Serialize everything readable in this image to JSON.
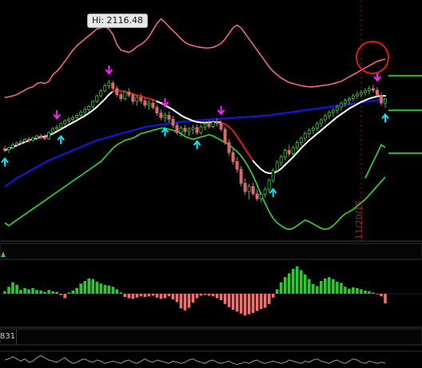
{
  "annotations": {
    "hi_label": "Hi: 2116.48",
    "vertical_date": "11/20/15",
    "indicator_readout": "831"
  },
  "colors": {
    "background": "#000000",
    "candle_up": "#3fbf3f",
    "candle_down": "#d86a6a",
    "upper_band": "#f26a6a",
    "lower_band": "#2ec82e",
    "long_ma": "#1515cc",
    "short_ma_up": "#ffffff",
    "short_ma_down": "#d81e1e",
    "buy_arrow": "#00e5ff",
    "sell_arrow": "#ff22ff",
    "hist_pos": "#2ec82e",
    "hist_neg": "#f07070",
    "target_line": "#22c022",
    "date_line": "#6a1a1a",
    "circle": "#e01818"
  },
  "chart_data": [
    {
      "type": "candlestick",
      "title": "",
      "annotations": [
        "Hi: 2116.48",
        "11/20/15"
      ],
      "ohlc": [
        [
          1993,
          1998,
          1987,
          1991
        ],
        [
          1991,
          1997,
          1985,
          1995
        ],
        [
          1995,
          2004,
          1992,
          2000
        ],
        [
          2000,
          2006,
          1996,
          2003
        ],
        [
          2003,
          2009,
          2000,
          2006
        ],
        [
          2006,
          2012,
          2003,
          2010
        ],
        [
          2010,
          2014,
          2004,
          2008
        ],
        [
          2008,
          2015,
          2005,
          2012
        ],
        [
          2012,
          2018,
          2008,
          2016
        ],
        [
          2016,
          2020,
          2010,
          2013
        ],
        [
          2013,
          2019,
          2008,
          2011
        ],
        [
          2011,
          2024,
          2009,
          2022
        ],
        [
          2022,
          2032,
          2019,
          2029
        ],
        [
          2029,
          2036,
          2024,
          2031
        ],
        [
          2031,
          2040,
          2027,
          2038
        ],
        [
          2038,
          2046,
          2034,
          2043
        ],
        [
          2043,
          2050,
          2038,
          2046
        ],
        [
          2046,
          2053,
          2041,
          2049
        ],
        [
          2049,
          2056,
          2044,
          2053
        ],
        [
          2053,
          2062,
          2049,
          2059
        ],
        [
          2059,
          2068,
          2054,
          2063
        ],
        [
          2063,
          2072,
          2058,
          2069
        ],
        [
          2069,
          2080,
          2065,
          2078
        ],
        [
          2078,
          2090,
          2075,
          2088
        ],
        [
          2088,
          2100,
          2085,
          2097
        ],
        [
          2097,
          2110,
          2094,
          2106
        ],
        [
          2106,
          2116.48,
          2101,
          2111
        ],
        [
          2111,
          2115,
          2098,
          2101
        ],
        [
          2101,
          2106,
          2086,
          2090
        ],
        [
          2090,
          2095,
          2078,
          2083
        ],
        [
          2083,
          2098,
          2080,
          2095
        ],
        [
          2095,
          2102,
          2085,
          2089
        ],
        [
          2089,
          2094,
          2072,
          2078
        ],
        [
          2078,
          2089,
          2070,
          2085
        ],
        [
          2085,
          2092,
          2074,
          2079
        ],
        [
          2079,
          2085,
          2066,
          2071
        ],
        [
          2071,
          2080,
          2063,
          2075
        ],
        [
          2075,
          2082,
          2063,
          2067
        ],
        [
          2067,
          2072,
          2052,
          2057
        ],
        [
          2057,
          2064,
          2044,
          2049
        ],
        [
          2049,
          2058,
          2041,
          2053
        ],
        [
          2053,
          2060,
          2040,
          2046
        ],
        [
          2046,
          2052,
          2030,
          2035
        ],
        [
          2035,
          2040,
          2018,
          2022
        ],
        [
          2022,
          2034,
          2015,
          2030
        ],
        [
          2030,
          2036,
          2018,
          2024
        ],
        [
          2024,
          2032,
          2016,
          2028
        ],
        [
          2028,
          2036,
          2019,
          2031
        ],
        [
          2031,
          2036,
          2018,
          2022
        ],
        [
          2022,
          2036,
          2018,
          2032
        ],
        [
          2032,
          2041,
          2026,
          2037
        ],
        [
          2037,
          2044,
          2029,
          2033
        ],
        [
          2033,
          2044,
          2030,
          2041
        ],
        [
          2041,
          2048,
          2033,
          2038
        ],
        [
          2038,
          2044,
          2024,
          2028
        ],
        [
          2028,
          2032,
          2000,
          2004
        ],
        [
          2004,
          2010,
          1980,
          1986
        ],
        [
          1986,
          1992,
          1964,
          1970
        ],
        [
          1970,
          1978,
          1950,
          1956
        ],
        [
          1956,
          1962,
          1925,
          1931
        ],
        [
          1931,
          1940,
          1910,
          1916
        ],
        [
          1916,
          1930,
          1902,
          1925
        ],
        [
          1925,
          1932,
          1908,
          1912
        ],
        [
          1912,
          1920,
          1899,
          1903
        ],
        [
          1903,
          1915,
          1897,
          1911
        ],
        [
          1911,
          1924,
          1905,
          1920
        ],
        [
          1920,
          1940,
          1914,
          1936
        ],
        [
          1936,
          1958,
          1932,
          1954
        ],
        [
          1954,
          1972,
          1950,
          1968
        ],
        [
          1968,
          1982,
          1962,
          1978
        ],
        [
          1978,
          1994,
          1972,
          1990
        ],
        [
          1990,
          2000,
          1979,
          1984
        ],
        [
          1984,
          1998,
          1980,
          1995
        ],
        [
          1995,
          2008,
          1990,
          2004
        ],
        [
          2004,
          2016,
          1998,
          2012
        ],
        [
          2012,
          2024,
          2006,
          2020
        ],
        [
          2020,
          2030,
          2013,
          2026
        ],
        [
          2026,
          2034,
          2020,
          2030
        ],
        [
          2030,
          2042,
          2025,
          2038
        ],
        [
          2038,
          2048,
          2032,
          2045
        ],
        [
          2045,
          2056,
          2040,
          2052
        ],
        [
          2052,
          2062,
          2046,
          2058
        ],
        [
          2058,
          2066,
          2050,
          2062
        ],
        [
          2062,
          2072,
          2056,
          2068
        ],
        [
          2068,
          2078,
          2062,
          2075
        ],
        [
          2075,
          2084,
          2068,
          2080
        ],
        [
          2080,
          2087,
          2072,
          2083
        ],
        [
          2083,
          2092,
          2078,
          2088
        ],
        [
          2088,
          2096,
          2082,
          2091
        ],
        [
          2091,
          2099,
          2085,
          2094
        ],
        [
          2094,
          2102,
          2088,
          2097
        ],
        [
          2097,
          2106,
          2090,
          2101
        ],
        [
          2101,
          2108,
          2094,
          2098
        ],
        [
          2098,
          2104,
          2085,
          2089
        ],
        [
          2089,
          2094,
          2070,
          2075
        ],
        [
          2075,
          2085,
          2066,
          2082
        ]
      ],
      "overlays": {
        "short_ma": [
          1990,
          1993,
          1996,
          1999,
          2002,
          2005,
          2008,
          2010,
          2012,
          2014,
          2015,
          2017,
          2020,
          2024,
          2028,
          2032,
          2036,
          2040,
          2044,
          2048,
          2052,
          2057,
          2062,
          2068,
          2075,
          2082,
          2090,
          2096,
          2098,
          2097,
          2095,
          2093,
          2091,
          2089,
          2087,
          2085,
          2083,
          2081,
          2078,
          2075,
          2071,
          2067,
          2063,
          2058,
          2053,
          2049,
          2046,
          2043,
          2041,
          2040,
          2040,
          2040,
          2041,
          2041,
          2040,
          2037,
          2032,
          2025,
          2015,
          2004,
          1993,
          1982,
          1971,
          1963,
          1956,
          1951,
          1949,
          1949,
          1952,
          1957,
          1964,
          1971,
          1978,
          1986,
          1994,
          2001,
          2008,
          2014,
          2020,
          2026,
          2032,
          2038,
          2044,
          2050,
          2055,
          2060,
          2065,
          2069,
          2073,
          2077,
          2080,
          2083,
          2085,
          2087,
          2088,
          2088
        ],
        "short_ma_red_segments": [
          [
            27,
            38
          ],
          [
            54,
            62
          ]
        ],
        "long_ma": [
          1925,
          1930,
          1935,
          1940,
          1944,
          1948,
          1952,
          1956,
          1960,
          1964,
          1968,
          1972,
          1975,
          1978,
          1981,
          1984,
          1987,
          1990,
          1993,
          1996,
          1999,
          2002,
          2005,
          2008,
          2010,
          2012,
          2014,
          2016,
          2018,
          2020,
          2022,
          2024,
          2026,
          2028,
          2030,
          2032,
          2033,
          2034,
          2035,
          2036,
          2037,
          2038,
          2039,
          2040,
          2041,
          2042,
          2042,
          2043,
          2044,
          2044,
          2045,
          2045,
          2046,
          2046,
          2047,
          2047,
          2048,
          2048,
          2049,
          2049,
          2050,
          2050,
          2051,
          2051,
          2052,
          2052,
          2053,
          2054,
          2055,
          2056,
          2057,
          2058,
          2059,
          2060,
          2061,
          2062,
          2063,
          2064,
          2065,
          2066,
          2067,
          2068,
          2069,
          2070,
          2071,
          2072,
          2073,
          2074,
          2075,
          2076,
          2077,
          2078,
          2079,
          2080,
          2081,
          2082
        ],
        "upper_band": [
          2085,
          2086,
          2088,
          2090,
          2094,
          2098,
          2102,
          2104,
          2110,
          2112,
          2110,
          2114,
          2126,
          2132,
          2140,
          2150,
          2160,
          2170,
          2178,
          2184,
          2190,
          2196,
          2202,
          2208,
          2210,
          2212,
          2208,
          2198,
          2180,
          2170,
          2168,
          2166,
          2170,
          2176,
          2180,
          2186,
          2194,
          2206,
          2218,
          2226,
          2220,
          2212,
          2205,
          2198,
          2190,
          2184,
          2180,
          2178,
          2176,
          2175,
          2174,
          2174,
          2175,
          2178,
          2182,
          2190,
          2200,
          2210,
          2215,
          2210,
          2200,
          2190,
          2180,
          2170,
          2160,
          2150,
          2140,
          2132,
          2126,
          2120,
          2116,
          2112,
          2110,
          2108,
          2106,
          2105,
          2104,
          2104,
          2105,
          2106,
          2107,
          2108,
          2110,
          2112,
          2114,
          2118,
          2122,
          2126,
          2130,
          2134,
          2138,
          2142,
          2146,
          2150,
          2152,
          2154
        ],
        "lower_band": [
          1860,
          1855,
          1860,
          1865,
          1870,
          1875,
          1880,
          1885,
          1890,
          1895,
          1900,
          1905,
          1910,
          1915,
          1920,
          1925,
          1930,
          1935,
          1940,
          1945,
          1950,
          1955,
          1960,
          1965,
          1970,
          1978,
          1986,
          1994,
          2000,
          2004,
          2008,
          2010,
          2012,
          2016,
          2020,
          2022,
          2024,
          2026,
          2028,
          2030,
          2030,
          2028,
          2026,
          2024,
          2020,
          2015,
          2012,
          2010,
          2012,
          2014,
          2016,
          2018,
          2016,
          2012,
          2008,
          2004,
          2000,
          1994,
          1988,
          1980,
          1970,
          1958,
          1944,
          1928,
          1910,
          1895,
          1880,
          1868,
          1860,
          1855,
          1850,
          1848,
          1850,
          1855,
          1860,
          1865,
          1862,
          1858,
          1854,
          1850,
          1848,
          1850,
          1855,
          1862,
          1870,
          1876,
          1880,
          1884,
          1890,
          1896,
          1902,
          1910,
          1918,
          1926,
          1934,
          1942
        ],
        "lower_band_projection": [
          1940,
          1955,
          1970,
          1985,
          2000,
          1995
        ],
        "buy_arrows": [
          0,
          14,
          40,
          48,
          67,
          95
        ],
        "sell_arrows": [
          13,
          26,
          40,
          54,
          93
        ]
      },
      "target_levels": [
        2124,
        2062,
        1985
      ],
      "ylim": [
        1830,
        2260
      ]
    },
    {
      "type": "bar",
      "title": "",
      "series": [
        {
          "values": [
            0.4,
            1.1,
            1.8,
            1.4,
            0.6,
            0.9,
            0.7,
            0.9,
            0.6,
            0.5,
            0.3,
            0.6,
            0.4,
            0.3,
            -0.2,
            -0.7,
            0.2,
            0.5,
            0.9,
            1.6,
            2.0,
            2.4,
            2.3,
            1.9,
            1.6,
            1.4,
            1.3,
            1.1,
            0.7,
            0.2,
            -0.5,
            -0.7,
            -0.8,
            -0.6,
            -0.4,
            -0.5,
            -0.4,
            -0.3,
            -0.6,
            -0.8,
            -0.7,
            -0.4,
            -0.9,
            -1.3,
            -2.3,
            -2.6,
            -2.2,
            -1.4,
            -0.7,
            -0.3,
            -0.2,
            -0.3,
            -0.4,
            -0.7,
            -1.0,
            -1.6,
            -2.1,
            -2.5,
            -2.8,
            -3.1,
            -3.4,
            -3.2,
            -3.0,
            -2.7,
            -2.4,
            -2.2,
            -1.6,
            -0.6,
            0.7,
            1.8,
            2.6,
            3.2,
            3.9,
            4.3,
            3.7,
            3.0,
            2.3,
            1.5,
            1.2,
            2.0,
            2.4,
            2.6,
            2.3,
            1.9,
            1.7,
            1.1,
            0.8,
            1.0,
            0.9,
            0.7,
            0.5,
            0.4,
            0.2,
            -0.1,
            -0.4,
            -1.5
          ]
        }
      ]
    },
    {
      "type": "line",
      "title": "",
      "annotations": [
        "831"
      ],
      "series": [
        {
          "values": [
            0.5,
            0.6,
            0.8,
            0.6,
            0.4,
            0.6,
            0.3,
            0.4,
            0.7,
            0.9,
            0.7,
            0.5,
            0.4,
            0.3,
            0.5,
            0.7,
            0.4,
            0.2,
            0.3,
            0.5,
            0.6,
            0.4,
            0.3,
            0.5,
            0.4,
            0.2,
            0.3,
            0.4,
            0.3,
            0.2,
            0.4,
            0.5,
            0.3,
            0.2,
            0.4,
            0.6,
            0.4,
            0.3,
            0.5,
            0.4,
            0.3,
            0.2,
            0.4,
            0.3,
            0.2,
            0.3,
            0.5,
            0.6,
            0.4,
            0.3,
            0.2,
            0.4,
            0.5,
            0.3,
            0.2,
            0.3,
            0.4,
            0.2,
            0.1,
            0.2,
            0.3,
            0.2,
            0.4,
            0.5,
            0.3,
            0.2,
            0.3,
            0.4,
            0.3,
            0.2,
            0.3,
            0.5,
            0.4,
            0.3,
            0.2,
            0.4,
            0.3,
            0.5,
            0.6,
            0.4,
            0.3,
            0.2,
            0.4,
            0.5,
            0.3,
            0.2,
            0.4,
            0.6,
            0.5,
            0.3,
            0.2,
            0.4,
            0.3,
            0.2,
            0.3,
            0.2
          ]
        }
      ]
    }
  ]
}
